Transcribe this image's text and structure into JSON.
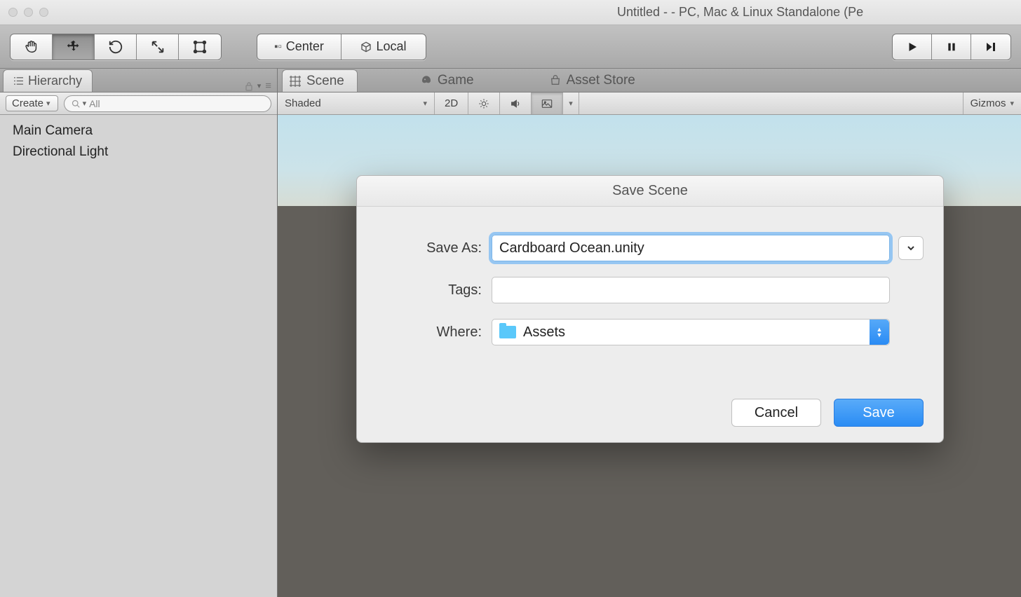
{
  "titlebar": {
    "title": "Untitled -  - PC, Mac & Linux Standalone (Pe"
  },
  "toolbar": {
    "pivot": "Center",
    "handle": "Local"
  },
  "hierarchy": {
    "tab_label": "Hierarchy",
    "create_label": "Create",
    "search_placeholder": "All",
    "items": [
      "Main Camera",
      "Directional Light"
    ]
  },
  "scene": {
    "tabs": [
      {
        "label": "Scene"
      },
      {
        "label": "Game"
      },
      {
        "label": "Asset Store"
      }
    ],
    "render_mode": "Shaded",
    "btn_2d": "2D",
    "gizmos": "Gizmos"
  },
  "dialog": {
    "title": "Save Scene",
    "save_as_label": "Save As:",
    "save_as_value": "Cardboard Ocean.unity",
    "tags_label": "Tags:",
    "tags_value": "",
    "where_label": "Where:",
    "where_value": "Assets",
    "cancel": "Cancel",
    "save": "Save"
  }
}
